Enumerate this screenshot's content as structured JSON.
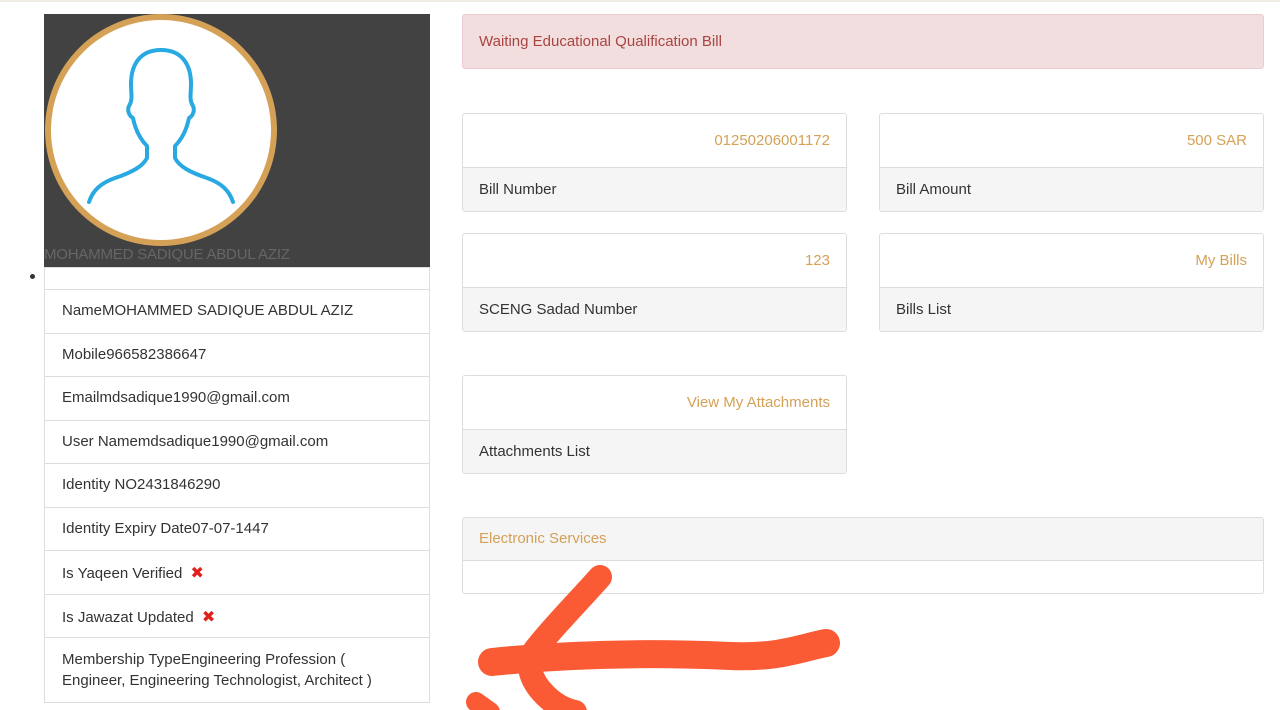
{
  "profile": {
    "display_name": "MOHAMMED SADIQUE ABDUL AZIZ",
    "fields": [
      {
        "label": "Name",
        "value": "MOHAMMED SADIQUE ABDUL AZIZ"
      },
      {
        "label": "Mobile",
        "value": "966582386647"
      },
      {
        "label": "Email",
        "value": "mdsadique1990@gmail.com"
      },
      {
        "label": "User Name",
        "value": "mdsadique1990@gmail.com"
      },
      {
        "label": "Identity NO",
        "value": "2431846290"
      },
      {
        "label": "Identity Expiry Date",
        "value": "07-07-1447"
      },
      {
        "label": "Is Yaqeen Verified",
        "value": "✖"
      },
      {
        "label": "Is Jawazat Updated",
        "value": "✖"
      },
      {
        "label": "Membership Type",
        "value": "Engineering Profession ( Engineer, Engineering Technologist, Architect )"
      }
    ]
  },
  "alert": {
    "message": "Waiting Educational Qualification Bill"
  },
  "panels": {
    "bill_number": {
      "value": "01250206001172",
      "label": "Bill Number"
    },
    "bill_amount": {
      "value": "500 SAR",
      "label": "Bill Amount"
    },
    "sadad_number": {
      "value": "123",
      "label": "SCENG Sadad Number"
    },
    "bills_list": {
      "value": "My Bills",
      "label": "Bills List"
    },
    "attachments": {
      "value": "View My Attachments",
      "label": "Attachments List"
    }
  },
  "services": {
    "title": "Electronic Services"
  },
  "colors": {
    "accent": "#d4a157",
    "alert_bg": "#f2dede",
    "alert_text": "#a94442",
    "annotation": "#fa5a34",
    "header_bg": "#424242",
    "avatar_stroke": "#29a9e1",
    "error_mark": "#e0201b"
  },
  "icons": {
    "avatar": "user-silhouette-icon",
    "not_verified": "red-x-icon",
    "annotation": "hand-drawn-arrow-icon"
  }
}
